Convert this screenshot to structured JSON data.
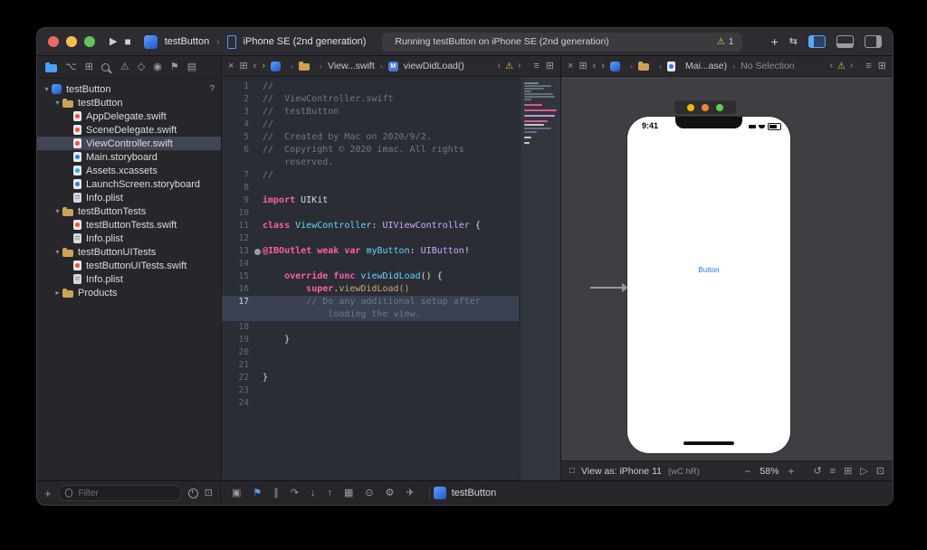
{
  "toolbar": {
    "icons": {
      "run": "▶",
      "stop": "■",
      "library_add": "+",
      "code_review": "⇆"
    },
    "scheme": "testButton",
    "destination": "iPhone SE (2nd generation)",
    "status": "Running testButton on iPhone SE (2nd generation)",
    "warning_glyph": "⚠",
    "warning_count": "1",
    "chevron": "›"
  },
  "navigator": {
    "filter_placeholder": "Filter",
    "bar_icons": [
      {
        "name": "project-navigator-icon",
        "cls": "icon-folder",
        "glyph": "",
        "active": true
      },
      {
        "name": "source-control-navigator-icon",
        "glyph": "⌥"
      },
      {
        "name": "symbol-navigator-icon",
        "glyph": "⊞"
      },
      {
        "name": "find-navigator-icon",
        "cls": "icon-find",
        "glyph": ""
      },
      {
        "name": "issue-navigator-icon",
        "glyph": "⚠"
      },
      {
        "name": "test-navigator-icon",
        "glyph": "◇"
      },
      {
        "name": "debug-navigator-icon",
        "glyph": "◉"
      },
      {
        "name": "breakpoint-navigator-icon",
        "glyph": "⚑"
      },
      {
        "name": "report-navigator-icon",
        "glyph": "▤"
      }
    ],
    "rows": [
      {
        "label": "testButton",
        "icon": "project",
        "indent": 0,
        "disclosure": "open",
        "badge": "?"
      },
      {
        "label": "testButton",
        "icon": "folder",
        "indent": 1,
        "disclosure": "open"
      },
      {
        "label": "AppDelegate.swift",
        "icon": "swift",
        "indent": 2
      },
      {
        "label": "SceneDelegate.swift",
        "icon": "swift",
        "indent": 2
      },
      {
        "label": "ViewController.swift",
        "icon": "swift",
        "indent": 2,
        "selected": true
      },
      {
        "label": "Main.storyboard",
        "icon": "storyboard",
        "indent": 2
      },
      {
        "label": "Assets.xcassets",
        "icon": "assets",
        "indent": 2
      },
      {
        "label": "LaunchScreen.storyboard",
        "icon": "storyboard",
        "indent": 2
      },
      {
        "label": "Info.plist",
        "icon": "plist",
        "indent": 2
      },
      {
        "label": "testButtonTests",
        "icon": "folder",
        "indent": 1,
        "disclosure": "open"
      },
      {
        "label": "testButtonTests.swift",
        "icon": "swift",
        "indent": 2
      },
      {
        "label": "Info.plist",
        "icon": "plist",
        "indent": 2
      },
      {
        "label": "testButtonUITests",
        "icon": "folder",
        "indent": 1,
        "disclosure": "open"
      },
      {
        "label": "testButtonUITests.swift",
        "icon": "swift",
        "indent": 2
      },
      {
        "label": "Info.plist",
        "icon": "plist",
        "indent": 2
      },
      {
        "label": "Products",
        "icon": "folder",
        "indent": 1,
        "disclosure": "closed"
      }
    ]
  },
  "editor": {
    "toolbar_icons_left": [
      {
        "name": "close-split-icon",
        "glyph": "×"
      },
      {
        "name": "related-items-icon",
        "glyph": "⊞"
      },
      {
        "name": "back-icon",
        "glyph": "‹"
      },
      {
        "name": "forward-icon",
        "glyph": "›"
      }
    ],
    "toolbar_icons_right": [
      {
        "name": "editor-options-icon",
        "glyph": "≡"
      },
      {
        "name": "add-editor-icon",
        "glyph": "⊞"
      }
    ],
    "issue_nav": {
      "prev": "‹",
      "warning": "⚠",
      "next": "›"
    },
    "breadcrumb": {
      "file": "View...swift",
      "symbol": "viewDidLoad()",
      "symbol_badge": "M"
    },
    "lines": [
      {
        "n": "1",
        "seg": [
          [
            "cm",
            "//"
          ]
        ]
      },
      {
        "n": "2",
        "seg": [
          [
            "cm",
            "//  ViewController.swift"
          ]
        ]
      },
      {
        "n": "3",
        "seg": [
          [
            "cm",
            "//  testButton"
          ]
        ]
      },
      {
        "n": "4",
        "seg": [
          [
            "cm",
            "//"
          ]
        ]
      },
      {
        "n": "5",
        "seg": [
          [
            "cm",
            "//  Created by Mac on 2020/9/2."
          ]
        ]
      },
      {
        "n": "6",
        "seg": [
          [
            "cm",
            "//  Copyright © 2020 imac. All rights"
          ]
        ]
      },
      {
        "n": "",
        "seg": [
          [
            "cm",
            "    reserved."
          ]
        ]
      },
      {
        "n": "7",
        "seg": [
          [
            "cm",
            "//"
          ]
        ]
      },
      {
        "n": "8",
        "seg": []
      },
      {
        "n": "9",
        "seg": [
          [
            "kw",
            "import"
          ],
          [
            "pl",
            " UIKit"
          ]
        ]
      },
      {
        "n": "10",
        "seg": []
      },
      {
        "n": "11",
        "seg": [
          [
            "kw",
            "class"
          ],
          [
            "pl",
            " "
          ],
          [
            "dc",
            "ViewController"
          ],
          [
            "pl",
            ": "
          ],
          [
            "ty",
            "UIViewController"
          ],
          [
            "pl",
            " {"
          ]
        ]
      },
      {
        "n": "12",
        "seg": []
      },
      {
        "n": "13",
        "w": true,
        "seg": [
          [
            "kw",
            "@IBOutlet"
          ],
          [
            "pl",
            " "
          ],
          [
            "kw",
            "weak"
          ],
          [
            "pl",
            " "
          ],
          [
            "kw",
            "var"
          ],
          [
            "pl",
            " "
          ],
          [
            "dc",
            "myButton"
          ],
          [
            "pl",
            ": "
          ],
          [
            "ty",
            "UIButton"
          ],
          [
            "pl",
            "!"
          ]
        ]
      },
      {
        "n": "14",
        "seg": []
      },
      {
        "n": "15",
        "seg": [
          [
            "pl",
            "    "
          ],
          [
            "kw",
            "override"
          ],
          [
            "pl",
            " "
          ],
          [
            "kw",
            "func"
          ],
          [
            "pl",
            " "
          ],
          [
            "dc",
            "viewDidLoad"
          ],
          [
            "pl",
            "() {"
          ]
        ]
      },
      {
        "n": "16",
        "seg": [
          [
            "pl",
            "        "
          ],
          [
            "kw",
            "super"
          ],
          [
            "pl",
            "."
          ],
          [
            "fn",
            "viewDidLoad()"
          ]
        ]
      },
      {
        "n": "17",
        "h": true,
        "seg": [
          [
            "pl",
            "        "
          ],
          [
            "cm",
            "// Do any additional setup after"
          ]
        ]
      },
      {
        "n": "",
        "h": true,
        "seg": [
          [
            "cm",
            "            loading the view."
          ]
        ]
      },
      {
        "n": "18",
        "seg": []
      },
      {
        "n": "19",
        "seg": [
          [
            "pl",
            "    }"
          ]
        ]
      },
      {
        "n": "20",
        "seg": []
      },
      {
        "n": "21",
        "seg": []
      },
      {
        "n": "22",
        "seg": [
          [
            "pl",
            "}"
          ]
        ]
      },
      {
        "n": "23",
        "seg": []
      },
      {
        "n": "24",
        "seg": []
      }
    ]
  },
  "storyboard": {
    "toolbar_icons_left": [
      {
        "name": "close-split-icon",
        "glyph": "×"
      },
      {
        "name": "related-items-icon",
        "glyph": "⊞"
      },
      {
        "name": "back-icon",
        "glyph": "‹"
      },
      {
        "name": "forward-icon",
        "glyph": "›"
      }
    ],
    "toolbar_icons_right": [
      {
        "name": "editor-options-icon",
        "glyph": "≡"
      },
      {
        "name": "add-editor-icon",
        "glyph": "⊞"
      }
    ],
    "issue_nav": {
      "prev": "‹",
      "warning": "⚠",
      "next": "›"
    },
    "breadcrumb": {
      "doc": "Mai...ase)",
      "selection": "No Selection"
    },
    "phone": {
      "time": "9:41",
      "button_label": "Button"
    },
    "bar": {
      "device_icon": "□",
      "view_as": "View as: iPhone 11",
      "traits": "(wC hR)",
      "zoom_out": "−",
      "zoom": "58%",
      "zoom_in": "+",
      "icons": [
        {
          "name": "update-frames-icon",
          "glyph": "↺"
        },
        {
          "name": "align-icon",
          "glyph": "≡"
        },
        {
          "name": "add-constraints-icon",
          "glyph": "⊞"
        },
        {
          "name": "resolve-autolayout-icon",
          "glyph": "▷"
        },
        {
          "name": "embed-in-icon",
          "glyph": "⊡"
        }
      ]
    }
  },
  "debugbar": {
    "add_glyph": "+",
    "icons": [
      {
        "name": "hide-debug-area-icon",
        "glyph": "▣"
      },
      {
        "name": "breakpoints-toggle-icon",
        "glyph": "⚑",
        "active": true
      },
      {
        "name": "pause-icon",
        "glyph": "∥"
      },
      {
        "name": "step-over-icon",
        "glyph": "↷"
      },
      {
        "name": "step-into-icon",
        "glyph": "↓"
      },
      {
        "name": "step-out-icon",
        "glyph": "↑"
      },
      {
        "name": "view-hierarchy-icon",
        "glyph": "▦"
      },
      {
        "name": "memory-graph-icon",
        "glyph": "⊙"
      },
      {
        "name": "environment-overrides-icon",
        "glyph": "⚙"
      },
      {
        "name": "simulate-location-icon",
        "glyph": "✈"
      }
    ],
    "process": "testButton"
  },
  "colors": {
    "accent_blue": "#4ba0f8",
    "warning_yellow": "#f6c344",
    "keyword_pink": "#fc5fa3",
    "comment_gray": "#6c7986",
    "type_purple": "#d0a8ff",
    "decl_cyan": "#5dd8ff"
  }
}
